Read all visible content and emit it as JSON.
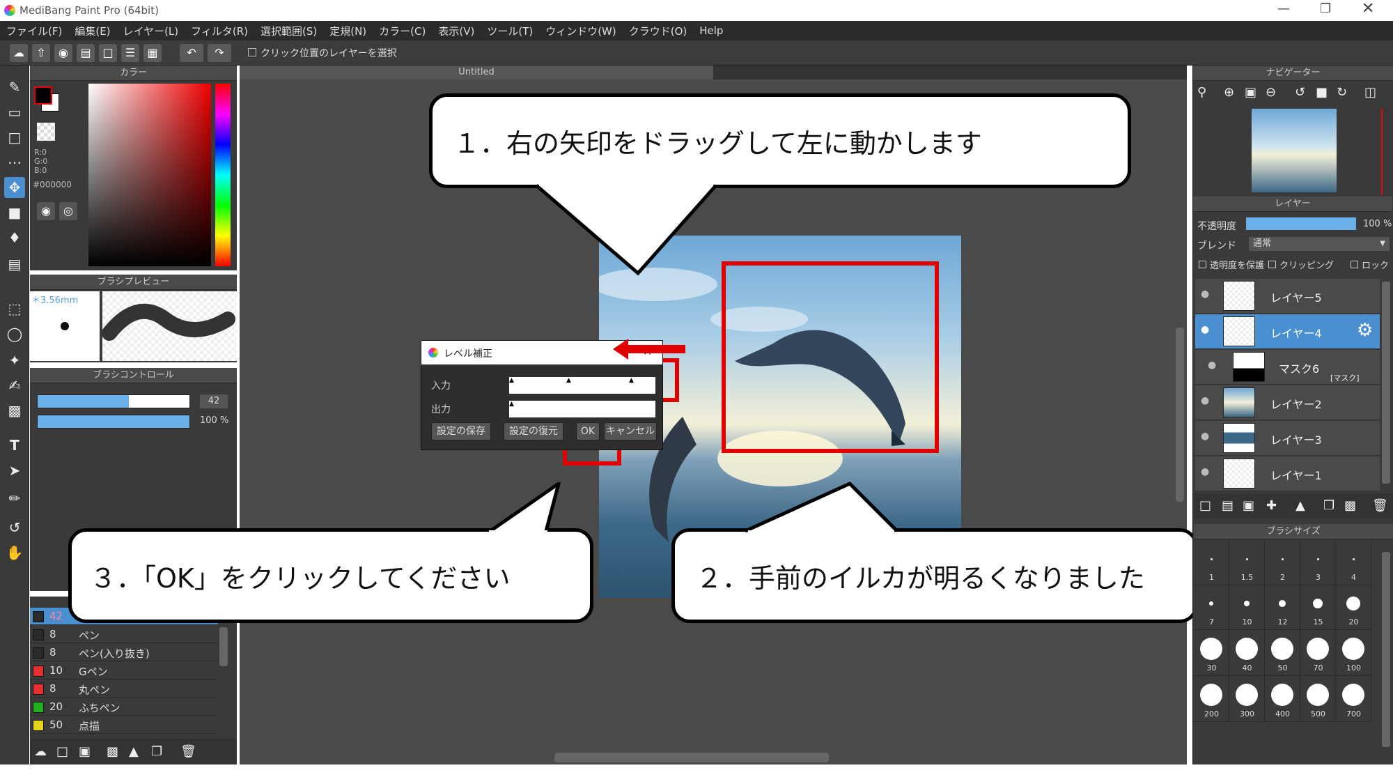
{
  "window": {
    "title": "MediBang Paint Pro (64bit)"
  },
  "menu": [
    "ファイル(F)",
    "編集(E)",
    "レイヤー(L)",
    "フィルタ(R)",
    "選択範囲(S)",
    "定規(N)",
    "カラー(C)",
    "表示(V)",
    "ツール(T)",
    "ウィンドウ(W)",
    "クラウド(O)",
    "Help"
  ],
  "toolbar": {
    "select_layer_checkbox": "クリック位置のレイヤーを選択"
  },
  "color_panel": {
    "title": "カラー",
    "r": "R:0",
    "g": "G:0",
    "b": "B:0",
    "hex": "#000000",
    "foreground": "#000000",
    "background": "#ffffff"
  },
  "brush_preview": {
    "title": "ブラシプレビュー",
    "size": "＊3.56mm"
  },
  "brush_control": {
    "title": "ブラシコントロール",
    "size_value": "42",
    "opacity_value": "100 %",
    "size_fraction": 0.6,
    "opacity_fraction": 1.0
  },
  "brush_list": [
    {
      "size": "42",
      "name": "",
      "color": "#2a2a2a"
    },
    {
      "size": "8",
      "name": "ペン",
      "color": "#2a2a2a"
    },
    {
      "size": "8",
      "name": "ペン(入り抜き)",
      "color": "#2a2a2a"
    },
    {
      "size": "10",
      "name": "Gペン",
      "color": "#e53030"
    },
    {
      "size": "8",
      "name": "丸ペン",
      "color": "#e53030"
    },
    {
      "size": "20",
      "name": "ふちペン",
      "color": "#22b022"
    },
    {
      "size": "50",
      "name": "点描",
      "color": "#e6d41a"
    }
  ],
  "canvas": {
    "tab": "Untitled"
  },
  "level_dialog": {
    "title": "レベル補正",
    "input_label": "入力",
    "output_label": "出力",
    "save": "設定の保存",
    "restore": "設定の復元",
    "ok": "OK",
    "cancel": "キャンセル"
  },
  "navigator": {
    "title": "ナビゲーター"
  },
  "layers": {
    "title": "レイヤー",
    "opacity_label": "不透明度",
    "opacity_value": "100 %",
    "opacity_fraction": 1.0,
    "blend_label": "ブレンド",
    "blend_value": "通常",
    "preserve": "透明度を保護",
    "clipping": "クリッピング",
    "lock": "ロック",
    "items": [
      {
        "name": "レイヤー5"
      },
      {
        "name": "レイヤー4"
      },
      {
        "name": "マスク6",
        "tag": "[マスク]"
      },
      {
        "name": "レイヤー2"
      },
      {
        "name": "レイヤー3"
      },
      {
        "name": "レイヤー1"
      }
    ]
  },
  "brush_size": {
    "title": "ブラシサイズ",
    "sizes": [
      "1",
      "1.5",
      "2",
      "3",
      "4",
      "7",
      "10",
      "12",
      "15",
      "20",
      "30",
      "40",
      "50",
      "70",
      "100",
      "200",
      "300",
      "400",
      "500",
      "700"
    ]
  },
  "callouts": {
    "step1": "１．右の矢印をドラッグして左に動かします",
    "step2": "２．手前のイルカが明るくなりました",
    "step3": "３．「OK」をクリックしてください"
  }
}
